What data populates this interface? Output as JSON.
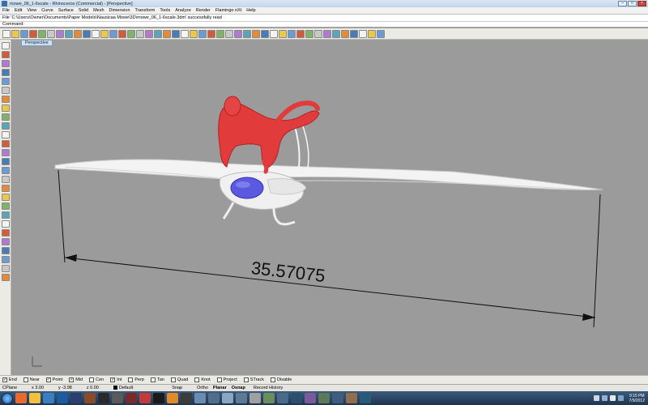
{
  "window": {
    "title": "mowe_06_1-6scale - Rhinoceros (Commercial) - [Perspective]"
  },
  "menu": [
    "File",
    "Edit",
    "View",
    "Curve",
    "Surface",
    "Solid",
    "Mesh",
    "Dimension",
    "Transform",
    "Tools",
    "Analyze",
    "Render",
    "Flamingo nXt",
    "Help"
  ],
  "history": {
    "text": "File 'C:\\Users\\Owner\\Documents\\Paper Models\\Nausicaa Mowe\\3D\\mowe_06_1-6scale.3dm' successfully read"
  },
  "command": {
    "label": "Command:",
    "value": ""
  },
  "viewport": {
    "tab": "Perspective",
    "dimension_text": "35.57075"
  },
  "osnaps": [
    {
      "label": "End",
      "checked": true
    },
    {
      "label": "Near",
      "checked": false
    },
    {
      "label": "Point",
      "checked": true
    },
    {
      "label": "Mid",
      "checked": true
    },
    {
      "label": "Cen",
      "checked": false
    },
    {
      "label": "Int",
      "checked": true
    },
    {
      "label": "Perp",
      "checked": false
    },
    {
      "label": "Tan",
      "checked": false
    },
    {
      "label": "Quad",
      "checked": false
    },
    {
      "label": "Knot",
      "checked": false
    },
    {
      "label": "Project",
      "checked": false
    },
    {
      "label": "STrack",
      "checked": false
    },
    {
      "label": "Disable",
      "checked": false
    }
  ],
  "status": {
    "cplane": "CPlane",
    "x": "x 3.00",
    "y": "y -3.98",
    "z": "z 0.00",
    "layer": "Default",
    "snap": "Snap",
    "ortho": "Ortho",
    "planar": "Planar",
    "osnap": "Osnap",
    "record_history": "Record History"
  },
  "clock": {
    "time": "9:15 PM",
    "date": "7/9/2012"
  },
  "colors": {
    "figure": "#e23b3b",
    "glider": "#f2f2f2",
    "canopy": "#5a5ae0",
    "viewport": "#9b9b9b"
  },
  "toolbar_icons": [
    "new",
    "open",
    "save",
    "print",
    "import",
    "cut",
    "copy",
    "paste",
    "undo",
    "pan",
    "rotate",
    "zoom",
    "zoom-window",
    "zoom-extents",
    "zoom-selected",
    "select",
    "grid",
    "layers",
    "properties",
    "render",
    "material",
    "light",
    "osnap",
    "points",
    "curve-tools",
    "surface-tools",
    "solid-tools",
    "mesh-tools",
    "dim",
    "transform",
    "array",
    "group",
    "block",
    "analyze",
    "render-preview",
    "flamingo",
    "help",
    "options",
    "command-list",
    "toolbox",
    "viewport",
    "shade",
    "wireframe"
  ],
  "left_tools": [
    "select",
    "point",
    "polyline",
    "curve",
    "circle",
    "arc",
    "ellipse",
    "rectangle",
    "polygon",
    "surface",
    "box",
    "sphere",
    "cylinder",
    "extrude",
    "boolean",
    "fillet",
    "trim",
    "split",
    "join",
    "explode",
    "move",
    "copy",
    "rotate",
    "scale",
    "mirror",
    "array",
    "dim"
  ],
  "taskbar": [
    "firefox",
    "explorer",
    "media",
    "photoshop",
    "bridge",
    "zbrush",
    "steam",
    "wire",
    "rhino",
    "flamingo",
    "dvd",
    "vlc",
    "rhino-cmd",
    "app1",
    "app2",
    "app3",
    "app4",
    "app5",
    "app6",
    "app7",
    "app8",
    "app9",
    "app10",
    "app11",
    "app12",
    "app13"
  ]
}
